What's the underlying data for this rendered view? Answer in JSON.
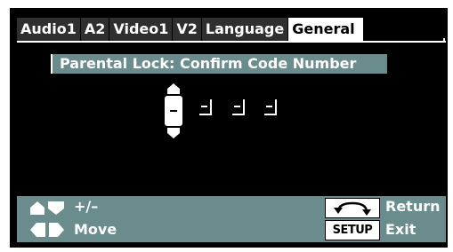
{
  "tabs": [
    {
      "label": "Audio1",
      "active": false
    },
    {
      "label": "A2",
      "active": false
    },
    {
      "label": "Video1",
      "active": false
    },
    {
      "label": "V2",
      "active": false
    },
    {
      "label": "Language",
      "active": false
    },
    {
      "label": "General",
      "active": true
    }
  ],
  "dialog": {
    "title": "Parental Lock: Confirm Code Number",
    "code_digits": 4,
    "active_digit": 1
  },
  "footer": {
    "adjust_label": "+/–",
    "move_label": "Move",
    "return_label": "Return",
    "setup_label": "SETUP",
    "exit_label": "Exit"
  },
  "colors": {
    "accent": "#6b8c8c",
    "background": "#000000",
    "tab_inactive": "#2f2f2f",
    "text": "#ffffff"
  },
  "icons": {
    "up_down": "up-down-arrows-icon",
    "left_right": "left-right-arrows-icon",
    "return": "return-arrow-icon"
  }
}
